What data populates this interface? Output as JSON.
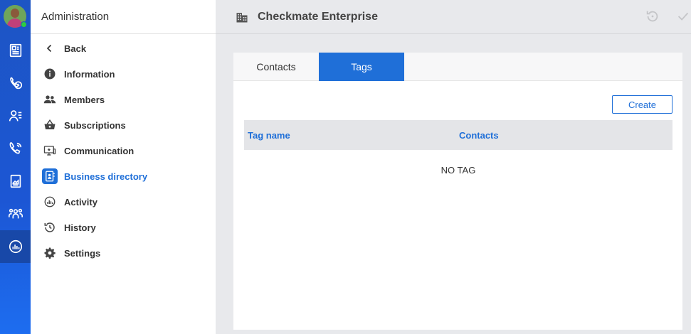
{
  "sidebar": {
    "title": "Administration",
    "items": [
      {
        "label": "Back",
        "icon": "chevron-left-icon"
      },
      {
        "label": "Information",
        "icon": "info-icon"
      },
      {
        "label": "Members",
        "icon": "people-icon"
      },
      {
        "label": "Subscriptions",
        "icon": "basket-icon"
      },
      {
        "label": "Communication",
        "icon": "monitor-star-icon"
      },
      {
        "label": "Business directory",
        "icon": "contact-book-icon",
        "active": true
      },
      {
        "label": "Activity",
        "icon": "activity-icon"
      },
      {
        "label": "History",
        "icon": "history-icon"
      },
      {
        "label": "Settings",
        "icon": "gear-icon"
      }
    ]
  },
  "rail": {
    "icons": [
      "newspaper-icon",
      "phone-clock-icon",
      "contacts-icon",
      "phone-call-icon",
      "image-card-icon",
      "group-icon",
      "analytics-icon"
    ],
    "active": "analytics-icon"
  },
  "header": {
    "title": "Checkmate Enterprise",
    "icon": "building-icon"
  },
  "tabs": [
    {
      "label": "Contacts"
    },
    {
      "label": "Tags",
      "active": true
    }
  ],
  "create_label": "Create",
  "table": {
    "columns": [
      "Tag name",
      "Contacts"
    ],
    "empty_text": "NO TAG"
  },
  "colors": {
    "accent": "#1f6fd8",
    "rail": "#1d55c4"
  }
}
